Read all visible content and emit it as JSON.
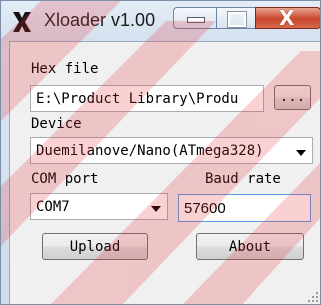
{
  "window": {
    "title": "Xloader v1.00",
    "icon": "x-logo-icon",
    "controls": {
      "minimize": "minimize-icon",
      "maximize": "maximize-icon",
      "close": "close-icon",
      "close_glyph": "X"
    }
  },
  "hex_file": {
    "label": "Hex file",
    "value": "E:\\Product Library\\Produ",
    "browse_label": "..."
  },
  "device": {
    "label": "Device",
    "selected": "Duemilanove/Nano(ATmega328)"
  },
  "com_port": {
    "label": "COM port",
    "selected": "COM7"
  },
  "baud_rate": {
    "label": "Baud rate",
    "value": "57600"
  },
  "buttons": {
    "upload": "Upload",
    "about": "About"
  },
  "colors": {
    "watermark": "#e8323c",
    "close_button": "#c8462c",
    "field_focus_border": "#569de5"
  }
}
